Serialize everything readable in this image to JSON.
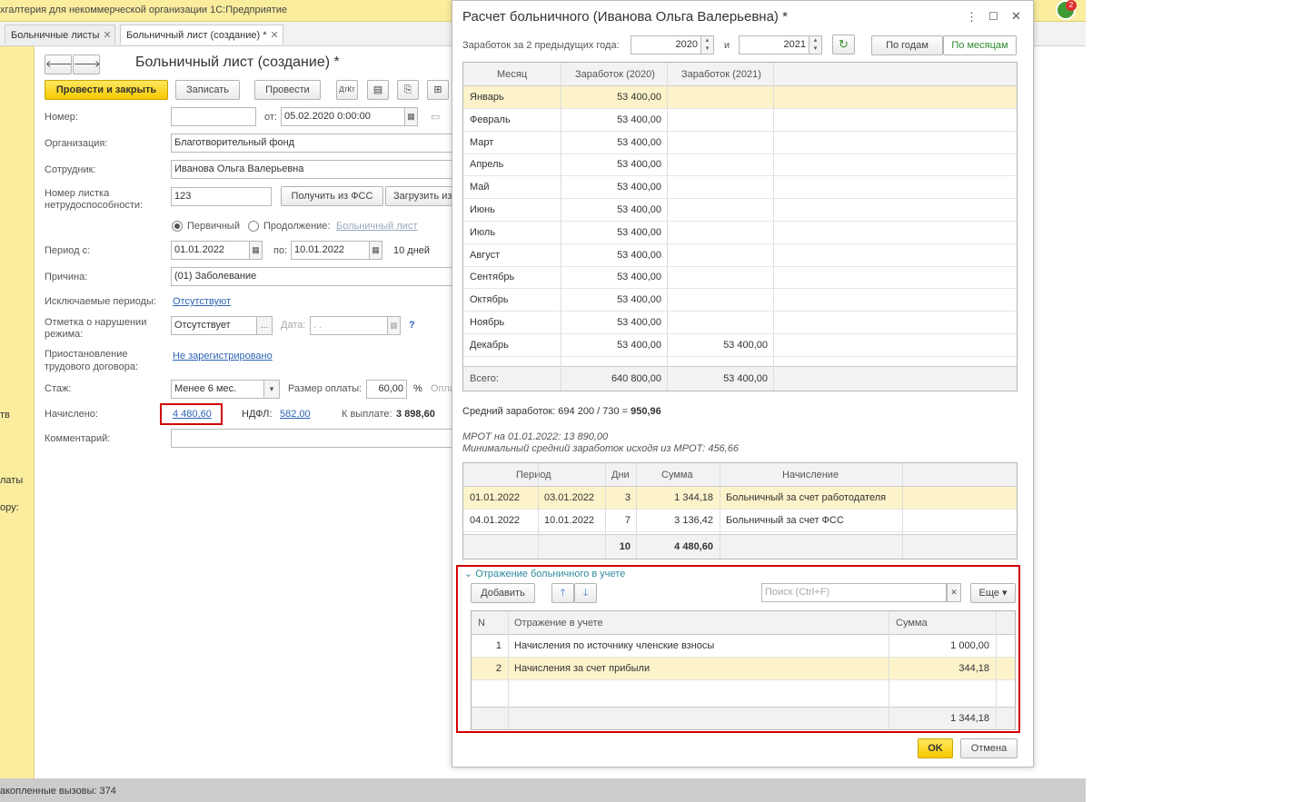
{
  "app_title": "хгалтерия для некоммерческой организации 1С:Предприятие",
  "tabs": [
    {
      "label": "Больничные листы"
    },
    {
      "label": "Больничный лист (создание) *"
    }
  ],
  "left_pane": {
    "a": "тв",
    "b": "латы",
    "c": "ору:"
  },
  "status": "акопленные вызовы: 374",
  "notif_count": "2",
  "form": {
    "title": "Больничный лист (создание) *",
    "btn_post_close": "Провести и закрыть",
    "btn_write": "Записать",
    "btn_post": "Провести",
    "number_label": "Номер:",
    "number_value": "",
    "from_label": "от:",
    "date_value": "05.02.2020  0:00:00",
    "org_label": "Организация:",
    "org_value": "Благотворительный фонд",
    "emp_label": "Сотрудник:",
    "emp_value": "Иванова Ольга Валерьевна",
    "sheet_label_1": "Номер листка",
    "sheet_label_2": "нетрудоспособности:",
    "sheet_value": "123",
    "btn_fss": "Получить из ФСС",
    "btn_load": "Загрузить из",
    "radio_primary": "Первичный",
    "radio_cont": "Продолжение:",
    "cont_link": "Больничный лист",
    "period_label": "Период с:",
    "period_from": "01.01.2022",
    "to_label": "по:",
    "period_to": "10.01.2022",
    "days": "10 дней",
    "reason_label": "Причина:",
    "reason_value": "(01) Заболевание",
    "excl_label": "Исключаемые периоды:",
    "excl_link": "Отсутствуют",
    "viol_label_1": "Отметка о нарушении",
    "viol_label_2": "режима:",
    "viol_value": "Отсутствует",
    "date_label": "Дата:",
    "date_ph": " .  .",
    "help": "?",
    "susp_label_1": "Приостановление",
    "susp_label_2": "трудового договора:",
    "susp_link": "Не зарегистрировано",
    "exp_label": "Стаж:",
    "exp_value": "Менее 6 мес.",
    "pay_label": "Размер оплаты:",
    "pay_value": "60,00",
    "pct": "%",
    "pay_more": "Опла",
    "accr_label": "Начислено:",
    "accr_link": "4 480,60",
    "ndfl_label": "НДФЛ:",
    "ndfl_link": "582,00",
    "payout_label": "К выплате:",
    "payout_value": "3 898,60",
    "comment_label": "Комментарий:"
  },
  "dialog": {
    "title": "Расчет больничного (Иванова Ольга Валерьевна) *",
    "earn_label": "Заработок за 2 предыдущих года:",
    "year1": "2020",
    "and": "и",
    "year2": "2021",
    "by_years": "По годам",
    "by_months": "По месяцам",
    "months_cols": [
      "Месяц",
      "Заработок (2020)",
      "Заработок (2021)"
    ],
    "months": [
      {
        "m": "Январь",
        "a": "53 400,00",
        "b": ""
      },
      {
        "m": "Февраль",
        "a": "53 400,00",
        "b": ""
      },
      {
        "m": "Март",
        "a": "53 400,00",
        "b": ""
      },
      {
        "m": "Апрель",
        "a": "53 400,00",
        "b": ""
      },
      {
        "m": "Май",
        "a": "53 400,00",
        "b": ""
      },
      {
        "m": "Июнь",
        "a": "53 400,00",
        "b": ""
      },
      {
        "m": "Июль",
        "a": "53 400,00",
        "b": ""
      },
      {
        "m": "Август",
        "a": "53 400,00",
        "b": ""
      },
      {
        "m": "Сентябрь",
        "a": "53 400,00",
        "b": ""
      },
      {
        "m": "Октябрь",
        "a": "53 400,00",
        "b": ""
      },
      {
        "m": "Ноябрь",
        "a": "53 400,00",
        "b": ""
      },
      {
        "m": "Декабрь",
        "a": "53 400,00",
        "b": "53 400,00"
      }
    ],
    "total_label": "Всего:",
    "total_a": "640 800,00",
    "total_b": "53 400,00",
    "avg_prefix": "Средний заработок: 694 200 / 730 = ",
    "avg_value": "950,96",
    "mrot_line": "МРОТ на 01.01.2022: 13 890,00",
    "mrot_min_line": "Минимальный средний заработок исходя из МРОТ: 456,66",
    "acc_cols": [
      "Период",
      "Дни",
      "Сумма",
      "Начисление"
    ],
    "accruals": [
      {
        "from": "01.01.2022",
        "to": "03.01.2022",
        "days": "3",
        "sum": "1 344,18",
        "kind": "Больничный за счет работодателя"
      },
      {
        "from": "04.01.2022",
        "to": "10.01.2022",
        "days": "7",
        "sum": "3 136,42",
        "kind": "Больничный за счет ФСС"
      }
    ],
    "acc_total_days": "10",
    "acc_total_sum": "4 480,60",
    "refl_title": "Отражение больничного в учете",
    "add": "Добавить",
    "search_ph": "Поиск (Ctrl+F)",
    "more": "Еще",
    "refl_cols": [
      "N",
      "Отражение в учете",
      "Сумма"
    ],
    "refl": [
      {
        "n": "1",
        "name": "Начисления по источнику членские взносы",
        "sum": "1 000,00"
      },
      {
        "n": "2",
        "name": "Начисления за счет прибыли",
        "sum": "344,18"
      }
    ],
    "refl_total": "1 344,18",
    "ok": "OK",
    "cancel": "Отмена"
  }
}
